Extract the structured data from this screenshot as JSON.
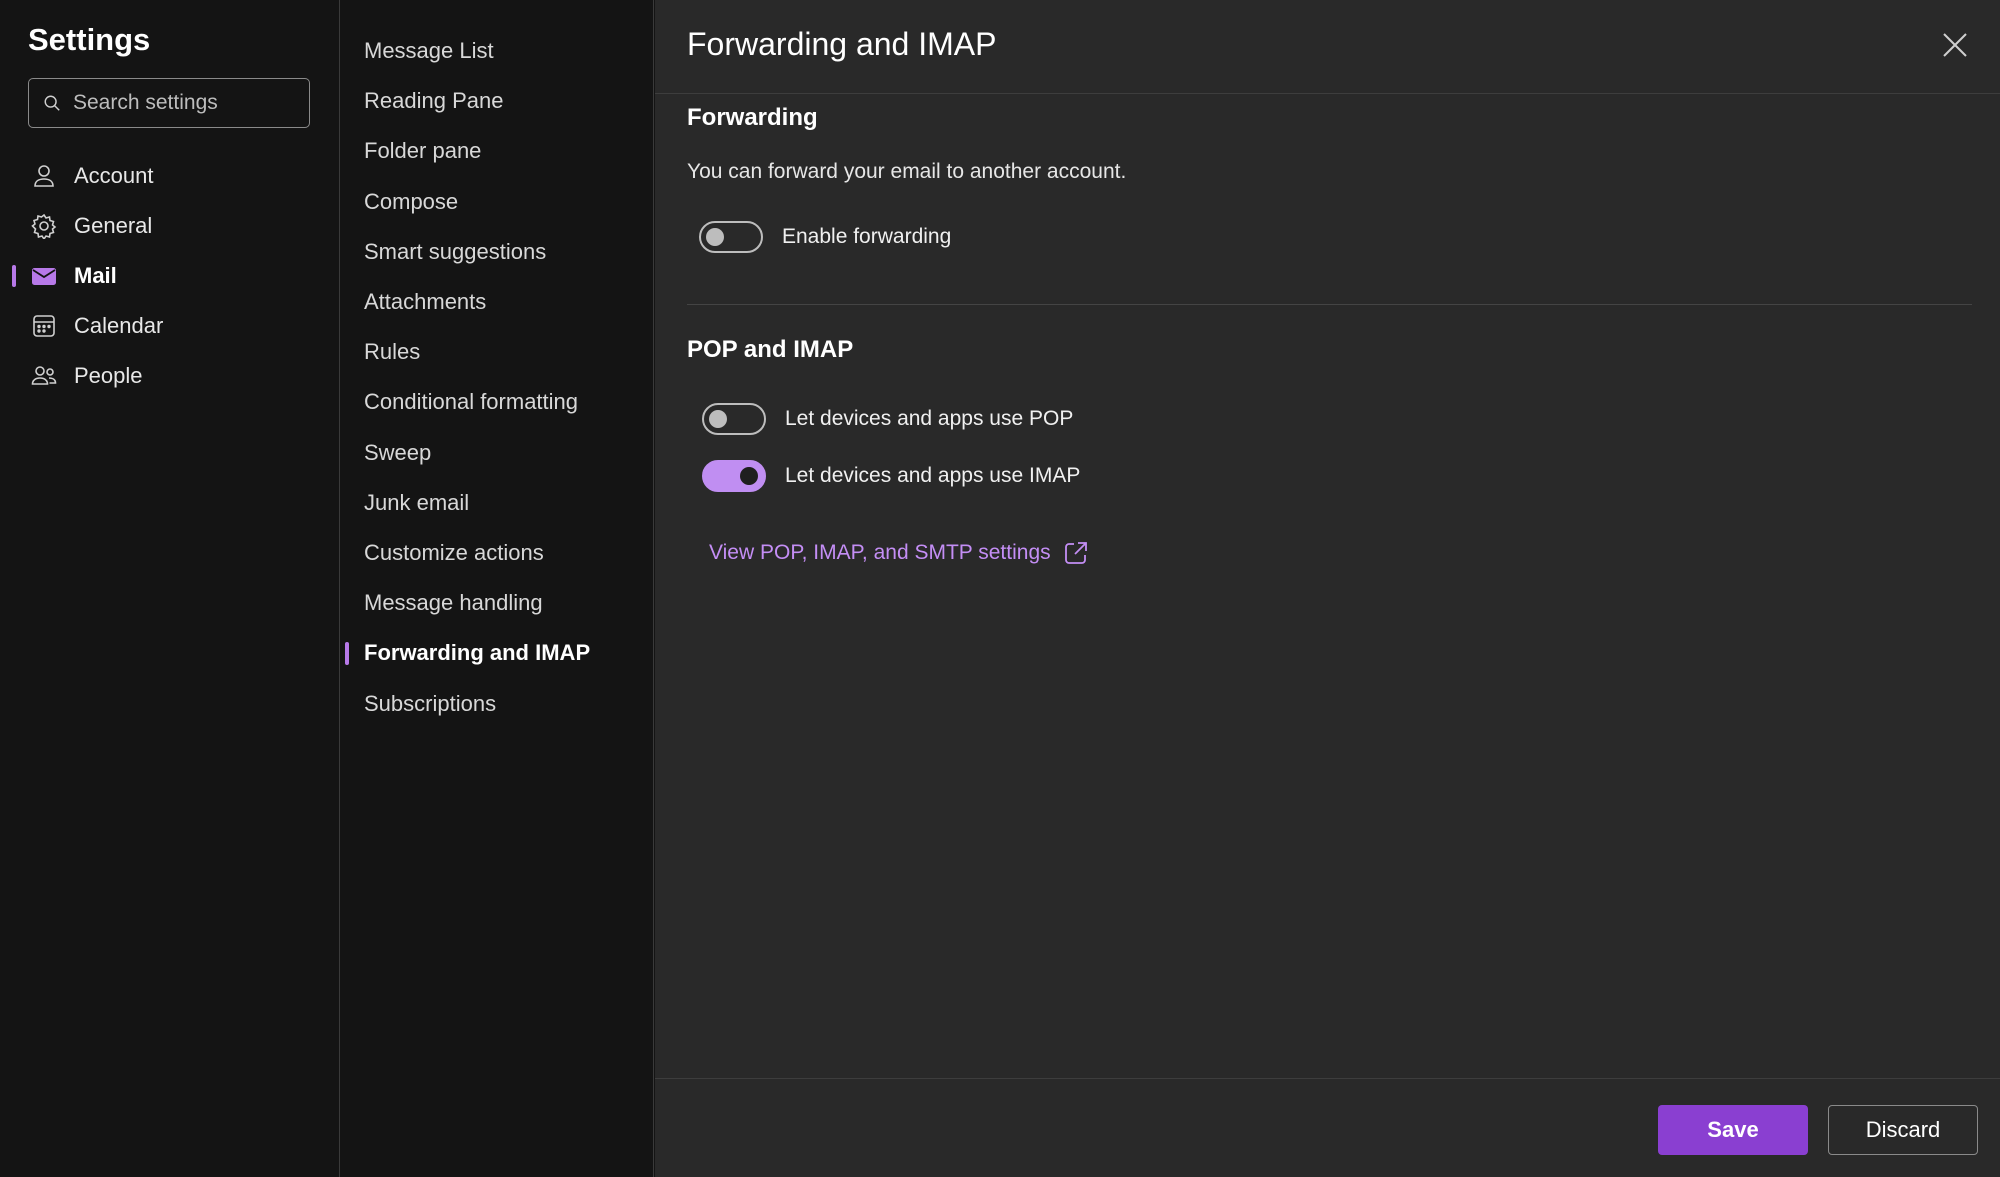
{
  "sidebar": {
    "title": "Settings",
    "search_placeholder": "Search settings",
    "items": [
      {
        "label": "Account",
        "icon": "person-icon"
      },
      {
        "label": "General",
        "icon": "gear-icon"
      },
      {
        "label": "Mail",
        "icon": "mail-icon",
        "active": true
      },
      {
        "label": "Calendar",
        "icon": "calendar-icon"
      },
      {
        "label": "People",
        "icon": "people-icon"
      }
    ]
  },
  "subnav": {
    "items": [
      {
        "label": "Message List"
      },
      {
        "label": "Reading Pane"
      },
      {
        "label": "Folder pane"
      },
      {
        "label": "Compose"
      },
      {
        "label": "Smart suggestions"
      },
      {
        "label": "Attachments"
      },
      {
        "label": "Rules"
      },
      {
        "label": "Conditional formatting"
      },
      {
        "label": "Sweep"
      },
      {
        "label": "Junk email"
      },
      {
        "label": "Customize actions"
      },
      {
        "label": "Message handling"
      },
      {
        "label": "Forwarding and IMAP",
        "active": true
      },
      {
        "label": "Subscriptions"
      }
    ]
  },
  "main": {
    "title": "Forwarding and IMAP",
    "forwarding": {
      "heading": "Forwarding",
      "description": "You can forward your email to another account.",
      "toggle_label": "Enable forwarding",
      "toggle_on": false
    },
    "pop_imap": {
      "heading": "POP and IMAP",
      "pop_label": "Let devices and apps use POP",
      "pop_on": false,
      "imap_label": "Let devices and apps use IMAP",
      "imap_on": true,
      "link_text": "View POP, IMAP, and SMTP settings"
    }
  },
  "footer": {
    "save_label": "Save",
    "discard_label": "Discard"
  },
  "colors": {
    "accent": "#b779e8",
    "save_button": "#8a3fd1",
    "link": "#c48ef5",
    "toggle_on": "#c08ef2"
  }
}
